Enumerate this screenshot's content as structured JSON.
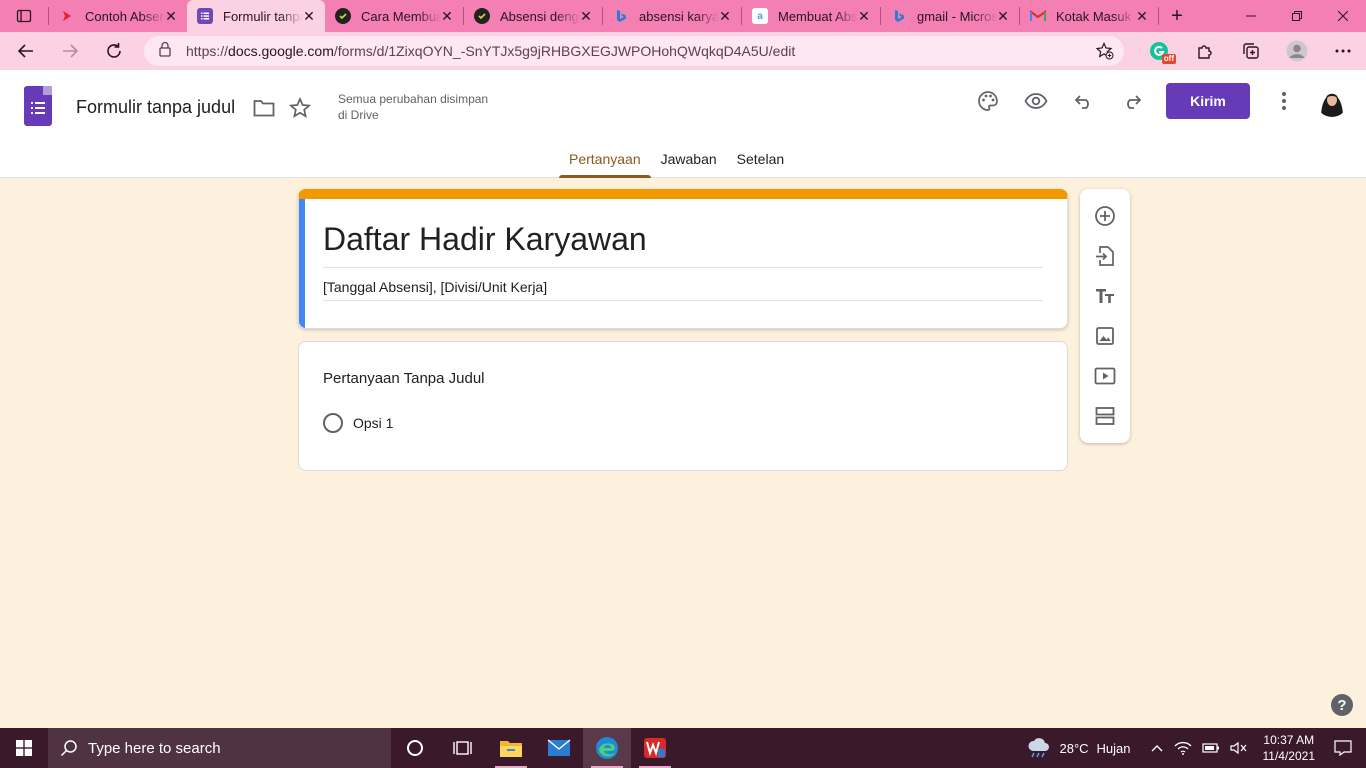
{
  "browser": {
    "tabs": [
      {
        "title": "Contoh Absensi",
        "favicon": "youtube-red-icon",
        "active": false
      },
      {
        "title": "Formulir tanpa judul",
        "favicon": "google-forms-icon",
        "active": true
      },
      {
        "title": "Cara Membuat",
        "favicon": "site-check-icon",
        "active": false
      },
      {
        "title": "Absensi dengan",
        "favicon": "site-check-icon",
        "active": false
      },
      {
        "title": "absensi karyawan",
        "favicon": "bing-icon",
        "active": false
      },
      {
        "title": "Membuat Absensi",
        "favicon": "a-letter-icon",
        "active": false
      },
      {
        "title": "gmail - Microsoft",
        "favicon": "bing-icon",
        "active": false
      },
      {
        "title": "Kotak Masuk",
        "favicon": "gmail-icon",
        "active": false
      }
    ],
    "url_prefix": "https://",
    "url_domain": "docs.google.com",
    "url_path": "/forms/d/1ZixqOYN_-SnYTJx5g9jRHBGXEGJWPOHohQWqkqD4A5U/edit",
    "extension_badge": "off"
  },
  "forms": {
    "doc_title": "Formulir tanpa judul",
    "save_status_line1": "Semua perubahan disimpan",
    "save_status_line2": "di Drive",
    "send_label": "Kirim",
    "tabs": [
      {
        "label": "Pertanyaan",
        "active": true
      },
      {
        "label": "Jawaban",
        "active": false
      },
      {
        "label": "Setelan",
        "active": false
      }
    ],
    "form_title": "Daftar Hadir Karyawan",
    "form_description": "[Tanggal Absensi], [Divisi/Unit Kerja]",
    "question": {
      "title": "Pertanyaan Tanpa Judul",
      "options": [
        "Opsi 1"
      ]
    },
    "help_label": "?"
  },
  "colors": {
    "accent": "#673ab7",
    "header_stripe": "#f29900",
    "focus_bar": "#4285f4",
    "background": "#fdf0dc",
    "active_tab": "#8a5a1c"
  },
  "taskbar": {
    "search_placeholder": "Type here to search",
    "weather_temp": "28°C",
    "weather_desc": "Hujan",
    "time": "10:37 AM",
    "date": "11/4/2021"
  }
}
